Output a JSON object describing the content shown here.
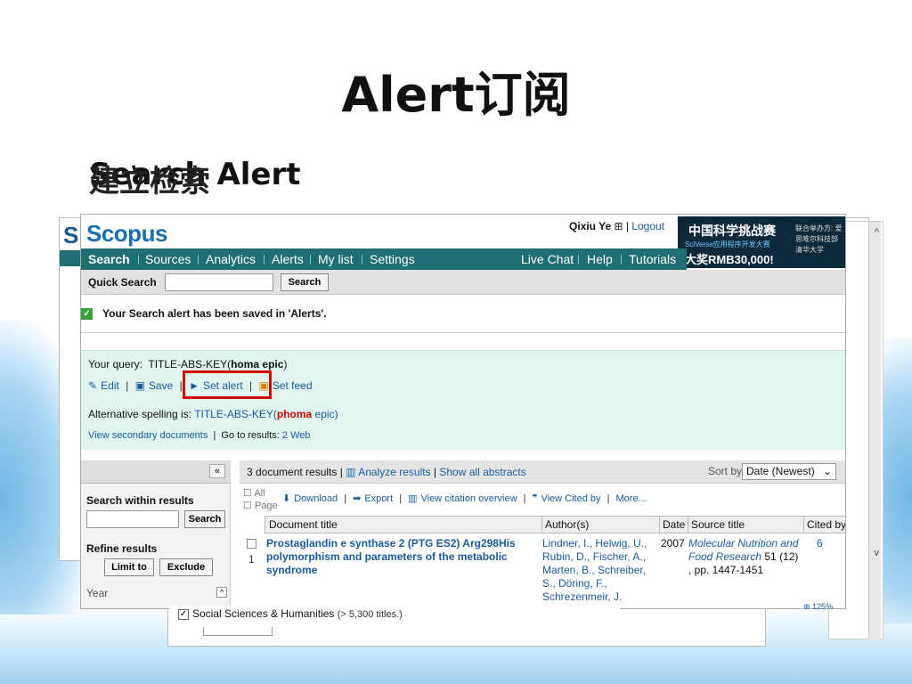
{
  "slide": {
    "title": "Alert订阅",
    "subtitle_layer1": "Search Alert",
    "subtitle_layer2": "建立检索"
  },
  "header": {
    "logo": "Scopus",
    "user_name": "Qixiu Ye",
    "logout": "Logout"
  },
  "ad": {
    "line1": "中国科学挑战赛",
    "line2": "SciVerse应用程序开发大赛",
    "line3": "大奖RMB30,000!",
    "side": "联合举办方: 爱思唯尔科技部 清华大学"
  },
  "nav": {
    "items": [
      "Search",
      "Sources",
      "Analytics",
      "Alerts",
      "My list",
      "Settings"
    ],
    "right": [
      "Live Chat",
      "Help",
      "Tutorials"
    ]
  },
  "quick_search": {
    "label": "Quick Search",
    "button": "Search"
  },
  "saved_message": "Your Search alert has been saved in 'Alerts'.",
  "query": {
    "label": "Your query:",
    "text_prefix": "TITLE-ABS-KEY(",
    "text_bold": "homa epic",
    "text_suffix": ")",
    "actions": [
      "Edit",
      "Save",
      "Set alert",
      "Set feed"
    ],
    "alt_label": "Alternative spelling is:",
    "alt_prefix": "TITLE-ABS-KEY(",
    "alt_red": "phoma",
    "alt_suffix": " epic)",
    "secondary_link": "View secondary documents",
    "go_to": "Go to results:",
    "go_count": "2",
    "go_web": "Web"
  },
  "left_panel": {
    "collapse": "«",
    "search_within": "Search within results",
    "search_button": "Search",
    "refine": "Refine results",
    "limit": "Limit to",
    "exclude": "Exclude",
    "year": "Year"
  },
  "results": {
    "count_text": "3 document results",
    "analyze": "Analyze results",
    "show_abstracts": "Show all abstracts",
    "sort_label": "Sort by",
    "sort_value": "Date (Newest)",
    "select_all": "All",
    "select_page": "Page",
    "tools": [
      "Download",
      "Export",
      "View citation overview",
      "View Cited by",
      "More..."
    ],
    "columns": [
      "Document title",
      "Author(s)",
      "Date",
      "Source title",
      "Cited by"
    ],
    "rows": [
      {
        "num": "1",
        "title": "Prostaglandin e synthase 2 (PTG ES2) Arg298His polymorphism and parameters of the metabolic syndrome",
        "authors": "Lindner, I., Helwig, U., Rubin, D., Fischer, A., Marten, B., Schreiber, S., Döring, F., Schrezenmeir, J.",
        "date": "2007",
        "source_title": "Molecular Nutrition and Food Research",
        "source_rest": " 51 (12) , pp. 1447-1451",
        "cited": "6"
      }
    ]
  },
  "overlay": {
    "subject": "Social Sciences & Humanities",
    "count": "(> 5,300 titles.)",
    "zoom": "125%"
  }
}
